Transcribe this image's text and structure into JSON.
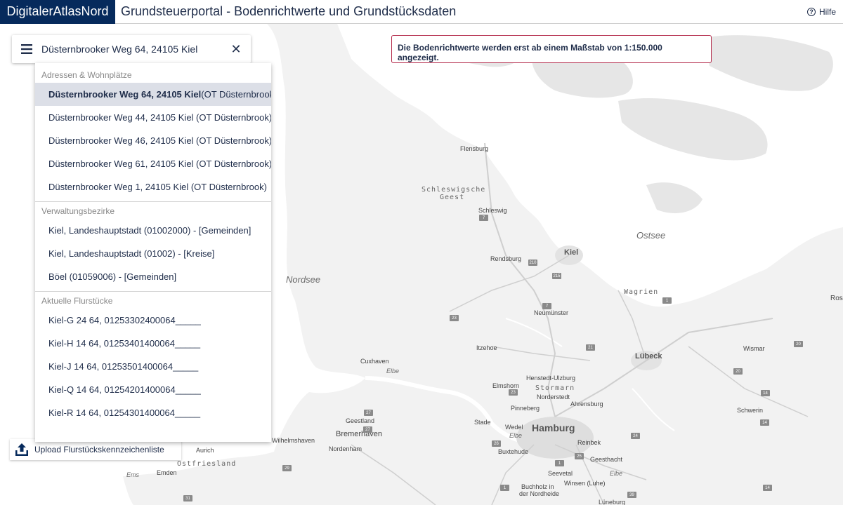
{
  "header": {
    "brand": "DigitalerAtlasNord",
    "title": "Grundsteuerportal - Bodenrichtwerte und Grundstücksdaten",
    "help_label": "Hilfe"
  },
  "search": {
    "value": "Düsternbrooker Weg 64, 24105 Kiel",
    "clear_symbol": "✕"
  },
  "suggestions": {
    "groups": [
      {
        "label": "Adressen & Wohnplätze",
        "items": [
          {
            "bold": "Düsternbrooker Weg 64, 24105 Kiel",
            "rest": " (OT Düsternbrook)"
          },
          {
            "text": "Düsternbrooker Weg 44, 24105 Kiel (OT Düsternbrook)"
          },
          {
            "text": "Düsternbrooker Weg 46, 24105 Kiel (OT Düsternbrook)"
          },
          {
            "text": "Düsternbrooker Weg 61, 24105 Kiel (OT Düsternbrook)"
          },
          {
            "text": "Düsternbrooker Weg 1, 24105 Kiel (OT Düsternbrook)"
          }
        ]
      },
      {
        "label": "Verwaltungsbezirke",
        "items": [
          {
            "text": "Kiel, Landeshauptstadt (01002000) - [Gemeinden]"
          },
          {
            "text": "Kiel, Landeshauptstadt (01002) - [Kreise]"
          },
          {
            "text": "Böel (01059006) - [Gemeinden]"
          }
        ]
      },
      {
        "label": "Aktuelle Flurstücke",
        "items": [
          {
            "text": "Kiel-G 24 64, 01253302400064_____"
          },
          {
            "text": "Kiel-H 14 64, 01253401400064_____"
          },
          {
            "text": "Kiel-J 14 64, 01253501400064_____"
          },
          {
            "text": "Kiel-Q 14 64, 01254201400064_____"
          },
          {
            "text": "Kiel-R 14 64, 01254301400064_____"
          }
        ]
      }
    ]
  },
  "notice": "Die Bodenrichtwerte werden erst ab einem Maßstab von 1:150.000 angezeigt.",
  "upload_label": "Upload Flurstückskennzeichenliste",
  "map": {
    "water_labels": {
      "ostsee": "Ostsee",
      "nordsee": "Nordsee",
      "elbe1": "Elbe",
      "elbe2": "Elbe",
      "elbe3": "Elbe",
      "ems": "Ems"
    },
    "regions": {
      "geest_line1": "Schleswigsche",
      "geest_line2": "Geest",
      "ostfriesland": "Ostfriesland",
      "stormarn": "Stormarn",
      "wagrien": "Wagrien"
    },
    "cities": {
      "flensburg": "Flensburg",
      "schleswig": "Schleswig",
      "kiel": "Kiel",
      "rendsburg": "Rendsburg",
      "neumuenster": "Neumünster",
      "itzehoe": "Itzehoe",
      "luebeck": "Lübeck",
      "wismar": "Wismar",
      "cuxhaven": "Cuxhaven",
      "henstedt": "Henstedt-Ulzburg",
      "norderstedt": "Norderstedt",
      "elmshorn": "Elmshorn",
      "ahrensburg": "Ahrensburg",
      "pinneberg": "Pinneberg",
      "schwerin": "Schwerin",
      "geestland": "Geestland",
      "bremerhaven": "Bremerhaven",
      "stade": "Stade",
      "wedel": "Wedel",
      "hamburg": "Hamburg",
      "wilhelmshaven": "Wilhelmshaven",
      "nordenham": "Nordenham",
      "aurich": "Aurich",
      "buxtehude": "Buxtehude",
      "reinbek": "Reinbek",
      "geesthacht": "Geesthacht",
      "seevetal": "Seevetal",
      "emden": "Emden",
      "buchholz": "Buchholz in",
      "buchholz2": "der Nordheide",
      "winsen": "Winsen (Luhe)",
      "lueneburg": "Lüneburg",
      "ros": "Ros"
    },
    "road_badges": {
      "b7a": "7",
      "b7b": "7",
      "b210": "210",
      "b215": "215",
      "b7c": "7",
      "b23": "23",
      "b21": "21",
      "b1": "1",
      "b20a": "20",
      "b20b": "20",
      "b14a": "14",
      "b14b": "14",
      "b23b": "23",
      "b27a": "27",
      "b27b": "27",
      "b7d": "7",
      "b26": "26",
      "b25": "25",
      "b24": "24",
      "b1b": "1",
      "b29": "29",
      "b31": "31",
      "b1c": "1",
      "b7e": "7",
      "b14c": "14",
      "b1d": "1",
      "b39": "39"
    }
  },
  "colors": {
    "brand_bg": "#062a5c",
    "text": "#1f2d4a",
    "notice_border": "#b32a4a",
    "land": "#f2f2f2",
    "water": "#ffffff",
    "active_item": "#dcdfe7"
  }
}
